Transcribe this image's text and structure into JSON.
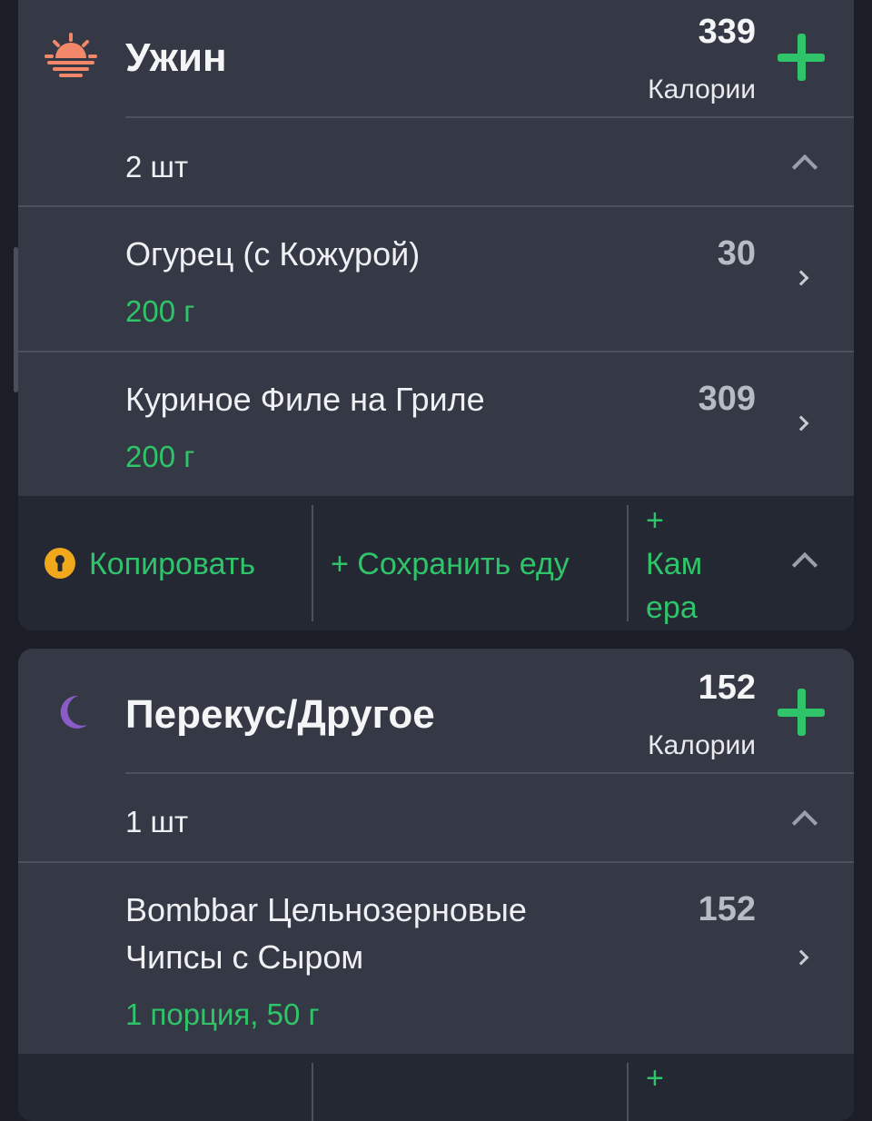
{
  "dinner": {
    "title": "Ужин",
    "calories": "339",
    "calories_label": "Калории",
    "count": "2 шт",
    "items": [
      {
        "name": "Огурец (с Кожурой)",
        "amount": "200 г",
        "calories": "30"
      },
      {
        "name": "Куриное Филе на Гриле",
        "amount": "200 г",
        "calories": "309"
      }
    ],
    "actions": {
      "copy": "Копировать",
      "save": "+ Сохранить еду",
      "camera_plus": "+",
      "camera_line1": "Кам",
      "camera_line2": "ера"
    }
  },
  "snack": {
    "title": "Перекус/Другое",
    "calories": "152",
    "calories_label": "Калории",
    "count": "1 шт",
    "items": [
      {
        "name_line1": "Bombbar Цельнозерновые",
        "name_line2": "Чипсы с Сыром",
        "amount": "1 порция, 50 г",
        "calories": "152"
      }
    ],
    "actions": {
      "camera_plus": "+"
    }
  },
  "colors": {
    "accent_green": "#2fc36a",
    "card_bg": "#353945",
    "page_bg": "#1b1e26",
    "sunset_icon": "#f2876a",
    "moon_icon": "#8b5cc8",
    "lock_icon": "#f0a81c"
  },
  "icons": {
    "dinner": "sunset-icon",
    "snack": "moon-icon",
    "add": "plus-icon",
    "expand": "chevron-up-icon",
    "open": "chevron-right-icon",
    "locked": "lock-icon"
  }
}
